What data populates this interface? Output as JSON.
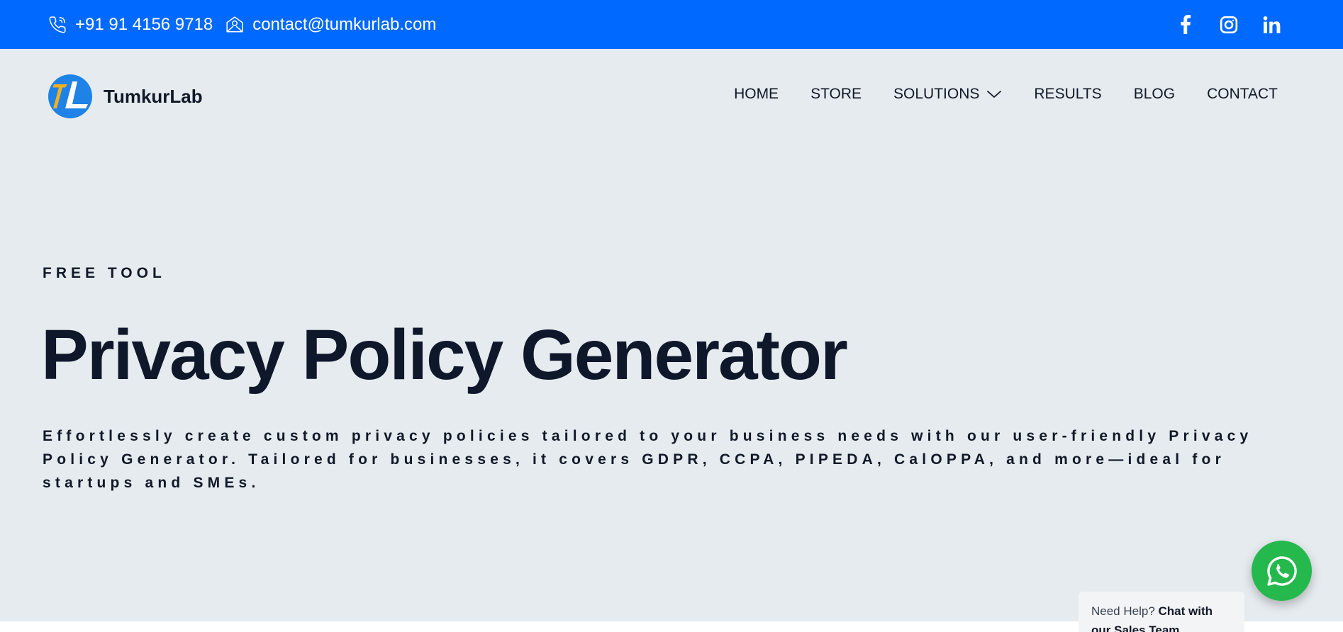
{
  "topbar": {
    "phone": "+91 91 4156 9718",
    "email": "contact@tumkurlab.com",
    "social": [
      "facebook-icon",
      "instagram-icon",
      "linkedin-icon"
    ],
    "background": "#0069ff"
  },
  "brand": {
    "name": "TumkurLab"
  },
  "nav": {
    "items": [
      "HOME",
      "STORE",
      "SOLUTIONS",
      "RESULTS",
      "BLOG",
      "CONTACT"
    ]
  },
  "hero": {
    "eyebrow": "FREE TOOL",
    "title": "Privacy Policy Generator",
    "description": "Effortlessly create custom privacy policies tailored to your business needs with our user-friendly Privacy Policy Generator. Tailored for businesses, it covers GDPR, CCPA, PIPEDA, CalOPPA, and more—ideal for startups and SMEs."
  },
  "chat": {
    "prefix": "Need Help?",
    "cta": "Chat with our Sales Team",
    "button_color": "#25b84c"
  }
}
